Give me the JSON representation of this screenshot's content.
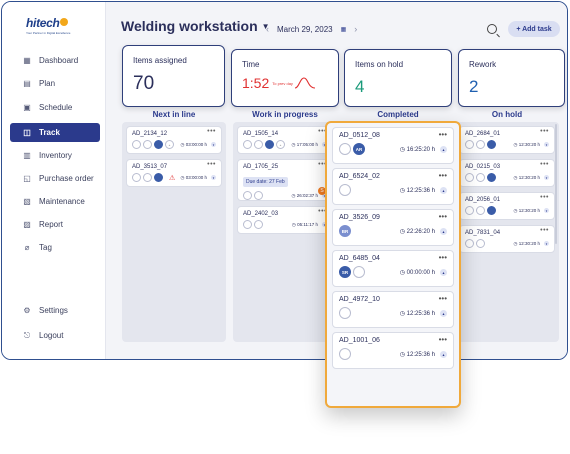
{
  "brand": {
    "name": "hitech",
    "tagline": "Your Partner in Digital Excellence"
  },
  "sidebar": {
    "items": [
      {
        "label": "Dashboard",
        "icon": "dashboard-icon",
        "glyph": "▦"
      },
      {
        "label": "Plan",
        "icon": "plan-icon",
        "glyph": "▤"
      },
      {
        "label": "Schedule",
        "icon": "schedule-icon",
        "glyph": "▣"
      },
      {
        "label": "Track",
        "icon": "track-icon",
        "glyph": "◫",
        "active": true
      },
      {
        "label": "Inventory",
        "icon": "inventory-icon",
        "glyph": "▥"
      },
      {
        "label": "Purchase order",
        "icon": "purchase-order-icon",
        "glyph": "◱"
      },
      {
        "label": "Maintenance",
        "icon": "maintenance-icon",
        "glyph": "▧"
      },
      {
        "label": "Report",
        "icon": "report-icon",
        "glyph": "▨"
      },
      {
        "label": "Tag",
        "icon": "tag-icon",
        "glyph": "⌀"
      }
    ],
    "bottom": [
      {
        "label": "Settings",
        "icon": "settings-icon",
        "glyph": "⚙"
      },
      {
        "label": "Logout",
        "icon": "logout-icon",
        "glyph": "⎋"
      }
    ]
  },
  "header": {
    "title": "Welding workstation",
    "date": "March 29, 2023",
    "add_task": "+ Add task"
  },
  "stats": {
    "assigned": {
      "label": "Items assigned",
      "value": "70"
    },
    "time": {
      "label": "Time",
      "value": "1:52",
      "note": "To prev day"
    },
    "on_hold": {
      "label": "Items on hold",
      "value": "4"
    },
    "rework": {
      "label": "Rework",
      "value": "2"
    }
  },
  "columns": {
    "next": "Next in line",
    "wip": "Work in progress",
    "completed": "Completed",
    "onhold": "On hold"
  },
  "next_cards": [
    {
      "id": "AD_2134_12",
      "time": "03:00:00 h"
    },
    {
      "id": "AD_3513_07",
      "time": "03:00:00 h"
    }
  ],
  "wip_cards": [
    {
      "id": "AD_1505_14",
      "time": "17:05:00 h"
    },
    {
      "id": "AD_1705_25",
      "time": "26:02:37 h",
      "due": "Due date: 27 Feb"
    },
    {
      "id": "AD_2402_03",
      "time": "05:11:17 h"
    }
  ],
  "onhold_cards": [
    {
      "id": "AD_2684_01",
      "time": "12:30:20 h"
    },
    {
      "id": "AD_0215_03",
      "time": "12:30:20 h"
    },
    {
      "id": "AD_2056_01",
      "time": "12:30:20 h"
    },
    {
      "id": "AD_7831_04",
      "time": "12:30:20 h"
    }
  ],
  "completed_cards": [
    {
      "id": "AD_0512_08",
      "time": "16:25:20 h",
      "avatar": "AR"
    },
    {
      "id": "AD_6524_02",
      "time": "12:25:36 h",
      "avatar": ""
    },
    {
      "id": "AD_3526_09",
      "time": "22:26:20 h",
      "avatar": "BR"
    },
    {
      "id": "AD_6485_04",
      "time": "00:00:00 h",
      "avatar": "SR"
    },
    {
      "id": "AD_4972_10",
      "time": "12:25:36 h",
      "avatar": ""
    },
    {
      "id": "AD_1001_06",
      "time": "12:25:36 h",
      "avatar": ""
    }
  ],
  "colors": {
    "accent": "#2b3a8c",
    "highlight": "#f0a93b",
    "time_red": "#e03030",
    "teal": "#1a9a7a",
    "blue": "#1f5fb0"
  }
}
